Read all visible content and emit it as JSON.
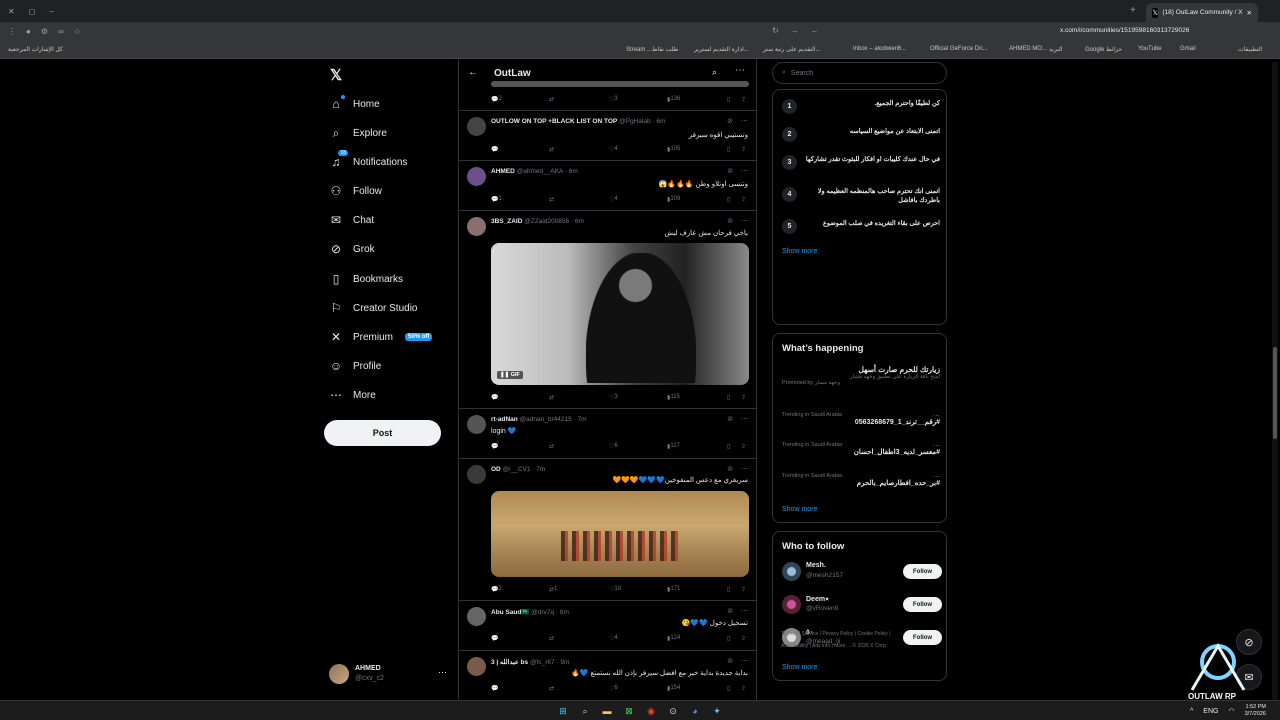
{
  "browser": {
    "tab_title": "(18) OutLaw Community / X",
    "url": "x.com/i/communities/1519598160313729026",
    "bookmarks": [
      "كل الإشارات المرجعية",
      "Stream ...طلب نقاط",
      "ادارة التقديم لسترير...",
      "التقديم على رتبة ستر...",
      "Inbox – alodwieri6...",
      "Official GeForce Dri...",
      "AHMED MO...",
      "البريد",
      "Google خرائط",
      "YouTube",
      "Gmail",
      "التطبيقات"
    ]
  },
  "nav": {
    "items": [
      {
        "label": "Home",
        "icon": "home-icon"
      },
      {
        "label": "Explore",
        "icon": "search-icon"
      },
      {
        "label": "Notifications",
        "icon": "bell-icon",
        "badge": "18"
      },
      {
        "label": "Follow",
        "icon": "follow-icon"
      },
      {
        "label": "Chat",
        "icon": "mail-icon"
      },
      {
        "label": "Grok",
        "icon": "grok-icon"
      },
      {
        "label": "Bookmarks",
        "icon": "bookmark-icon"
      },
      {
        "label": "Creator Studio",
        "icon": "creator-icon"
      },
      {
        "label": "Premium",
        "icon": "x-icon",
        "promo": "50% off"
      },
      {
        "label": "Profile",
        "icon": "person-icon"
      },
      {
        "label": "More",
        "icon": "more-circle-icon"
      }
    ],
    "post_label": "Post",
    "account": {
      "name": "AHMED",
      "handle": "@cxv_c2"
    }
  },
  "timeline": {
    "title": "OutLaw",
    "tweets": [
      {
        "name": "",
        "handle": "",
        "text": "",
        "replies": "2",
        "reposts": "",
        "likes": "3",
        "views": "136"
      },
      {
        "name": "OUTLOW ON TOP +BLACK LIST ON TOP",
        "handle": "@PgHalab · 6m",
        "text": "وتستيبي اقوه سيرفر",
        "replies": "",
        "reposts": "",
        "likes": "4",
        "views": "105"
      },
      {
        "name": "AHMED",
        "handle": "@ahmed__AKA · 6m",
        "text": "وتنسى اوتلاو وطن 🔥🔥🔥😱",
        "replies": "1",
        "reposts": "",
        "likes": "4",
        "views": "109"
      },
      {
        "name": "3BS_ZAID",
        "handle": "@ZZaid200856 · 6m",
        "text": "ياخي فرحان مش عارف ليش",
        "media_tag": "GIF",
        "replies": "",
        "reposts": "",
        "likes": "3",
        "views": "115"
      },
      {
        "name": "rt-adNan",
        "handle": "@adnan_br44215 · 7m",
        "text": "login 💙",
        "replies": "",
        "reposts": "",
        "likes": "6",
        "views": "117"
      },
      {
        "name": "OD",
        "handle": "@i__CV1 · 7m",
        "text": "سريفري مع دعس المنفوخين💙💙💙🧡🧡🧡",
        "replies": "2",
        "reposts": "1",
        "likes": "10",
        "views": "171"
      },
      {
        "name": "Abu Saud🇸🇦",
        "handle": "@drv7q · 8m",
        "text": "تسجيل دخول 💙💙😘",
        "replies": "",
        "reposts": "",
        "likes": "4",
        "views": "124"
      },
      {
        "name": "3 | عبدالله bs",
        "handle": "@fc_r67 · 9m",
        "text": "بداية جديدة بداية خير مع افضل سيرفر بإذن الله نستمتع 💙🔥",
        "replies": "",
        "reposts": "",
        "likes": "6",
        "views": "154"
      }
    ]
  },
  "right": {
    "search_placeholder": "Search",
    "rules": [
      {
        "num": "1",
        "text": "كن لطيفًا واحترم الجميع."
      },
      {
        "num": "2",
        "text": "اتمنى الابتعاد عن مواضيع السياسه"
      },
      {
        "num": "3",
        "text": "في حال عندك كليبات او افكار للبثوث تقدر تشاركها"
      },
      {
        "num": "4",
        "text": "اتمنى انك تحترم صاحب هالمنظمه العظيمه ولا باطردك بافاشل"
      },
      {
        "num": "5",
        "text": "احرص على بقاء التغريده في صلب الموضوع"
      }
    ],
    "show_more": "Show more",
    "happening_title": "What’s happening",
    "promoted": {
      "title": "زيارتك للحرم صارت أسهل",
      "subtitle": "امنح باقة الزيارة على تطبيق وجهة مسار",
      "by": "Promoted by وجهة مسار"
    },
    "trends": [
      {
        "context": "Trending in Saudi Arabia",
        "name": "#رقم__ترند_1_0563268679"
      },
      {
        "context": "Trending in Saudi Arabia",
        "name": "#معسر_لديه_3اطفال_احسان"
      },
      {
        "context": "Trending in Saudi Arabia",
        "name": "#بر_حده_افطارصايم_بالحرم"
      }
    ],
    "wtf_title": "Who to follow",
    "follow_label": "Follow",
    "suggestions": [
      {
        "name": "Mesh.",
        "handle": "@mesh2157"
      },
      {
        "name": "Deem٭",
        "handle": "@vRoven9"
      },
      {
        "name": "٥٠",
        "handle": "@meaad_iii"
      }
    ],
    "footer": [
      "Terms of Service",
      "Privacy Policy",
      "Cookie Policy",
      "Accessibility",
      "Ads info",
      "More ...",
      "© 2026 X Corp."
    ]
  },
  "watermark": "OUTLAW RP",
  "taskbar": {
    "time": "1:52 PM",
    "date": "3/7/2026",
    "lang": "ENG"
  },
  "colors": {
    "accent": "#1d9bf0",
    "bg": "#000000",
    "border": "#2f3336",
    "muted": "#71767b"
  }
}
